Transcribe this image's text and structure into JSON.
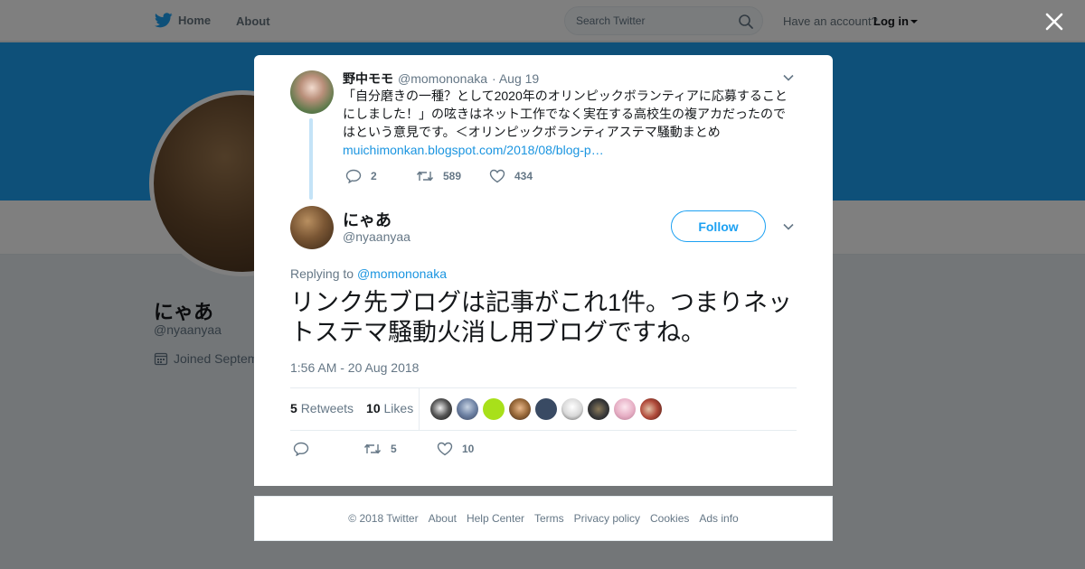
{
  "topbar": {
    "home_label": "Home",
    "about_label": "About",
    "search_placeholder": "Search Twitter",
    "have_account": "Have an account?",
    "login_label": "Log in"
  },
  "profile": {
    "name": "にゃあ",
    "handle": "@nyaanyaa",
    "joined": "Joined Septem"
  },
  "colors": {
    "brand": "#1da1f2",
    "link": "#1b95e0",
    "muted": "#657786"
  },
  "parent_tweet": {
    "name": "野中モモ",
    "handle": "@momononaka",
    "date": "· Aug 19",
    "text": "「自分磨きの一種？として2020年のオリンピックボランティアに応募することにしました！」の呟きはネット工作でなく実在する高校生の複アカだったのではという意見です。＜オリンピックボランティアステマ騒動まとめ",
    "link": "muichimonkan.blogspot.com/2018/08/blog-p…",
    "replies": "2",
    "retweets": "589",
    "likes": "434"
  },
  "main_tweet": {
    "name": "にゃあ",
    "handle": "@nyaanyaa",
    "follow_label": "Follow",
    "replying_to_label": "Replying to",
    "replying_to_handle": "@momononaka",
    "text": "リンク先ブログは記事がこれ1件。つまりネットステマ騒動火消し用ブログですね。",
    "timestamp": "1:56 AM - 20 Aug 2018",
    "retweets_count": "5",
    "retweets_label": "Retweets",
    "likes_count": "10",
    "likes_label": "Likes",
    "action_retweets": "5",
    "action_likes": "10"
  },
  "footer": {
    "copyright": "© 2018 Twitter",
    "links": [
      "About",
      "Help Center",
      "Terms",
      "Privacy policy",
      "Cookies",
      "Ads info"
    ]
  }
}
